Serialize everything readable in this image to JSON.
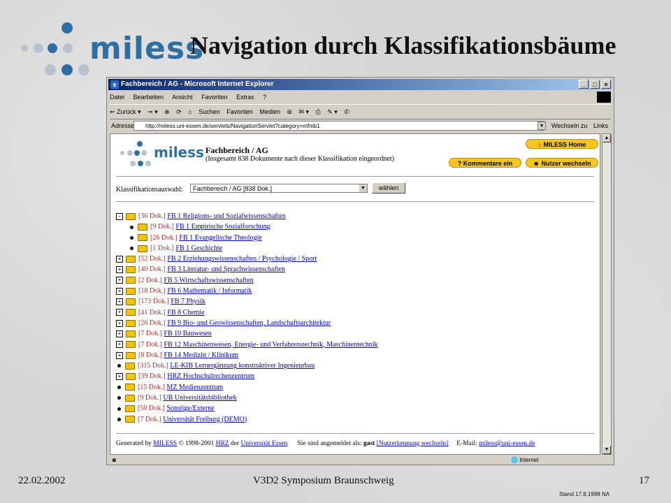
{
  "slide": {
    "title": "Navigation durch Klassifikationsbäume",
    "logo_text": "miless",
    "footer_date": "22.02.2002",
    "footer_event": "V3D2 Symposium Braunschweig",
    "footer_page": "17",
    "stand": "Stand 17.8.1998   NA"
  },
  "browser": {
    "window_title": "Fachbereich / AG - Microsoft Internet Explorer",
    "window_buttons": [
      "_",
      "□",
      "×"
    ],
    "menu": [
      "Datei",
      "Bearbeiten",
      "Ansicht",
      "Favoriten",
      "Extras",
      "?"
    ],
    "toolbar": [
      "⇐ Zurück ▾",
      "⇒ ▾",
      "⊗",
      "⟳",
      "⌂",
      "Suchen",
      "Favoriten",
      "Medien",
      "⊛",
      "✉ ▾",
      "⎙",
      "✎ ▾",
      "✆"
    ],
    "address_label": "Adresse",
    "address_value": "http://miless.uni-essen.de/servlets/NavigationServlet?category=mfmb1",
    "go_label": "Wechseln zu",
    "links_label": "Links",
    "status_zone": "Internet"
  },
  "page": {
    "logo_text": "miless",
    "heading": "Fachbereich / AG",
    "subheading": "(Insgesamt 838 Dokumente nach dieser Klassifikation eingeordnet)",
    "buttons": {
      "home": "MILESS Home",
      "comments": "Kommentare ein",
      "switch_user": "Nutzer wechseln"
    },
    "select_label": "Klassifikationsauswahl:",
    "select_value": "Fachbereich / AG [838 Dok.]",
    "select_button": "wählen",
    "tree": [
      {
        "type": "open",
        "indent": 0,
        "count": "[36 Dok.]",
        "label": "FB 1 Religions- und Sozialwissenschaften"
      },
      {
        "type": "leaf",
        "indent": 1,
        "count": "[9 Dok.]",
        "label": "FB 1 Empirische Sozialforschung"
      },
      {
        "type": "leaf",
        "indent": 1,
        "count": "[26 Dok.]",
        "label": "FB 1 Evangelische Theologie"
      },
      {
        "type": "leaf",
        "indent": 1,
        "count": "[1 Dok.]",
        "label": "FB 1 Geschichte"
      },
      {
        "type": "closed",
        "indent": 0,
        "count": "[52 Dok.]",
        "label": "FB 2 Erziehungswissenschaften / Psychologie / Sport"
      },
      {
        "type": "closed",
        "indent": 0,
        "count": "[40 Dok.]",
        "label": "FB 3 Literatur- und Sprachwissenschaften"
      },
      {
        "type": "closed",
        "indent": 0,
        "count": "[2 Dok.]",
        "label": "FB 5 Wirtschaftswissenschaften"
      },
      {
        "type": "closed",
        "indent": 0,
        "count": "[18 Dok.]",
        "label": "FB 6 Mathematik / Informatik"
      },
      {
        "type": "closed",
        "indent": 0,
        "count": "[173 Dok.]",
        "label": "FB 7 Physik"
      },
      {
        "type": "closed",
        "indent": 0,
        "count": "[41 Dok.]",
        "label": "FB 8 Chemie"
      },
      {
        "type": "closed",
        "indent": 0,
        "count": "[26 Dok.]",
        "label": "FB 9 Bio- und Geowissenschaften, Landschaftsarchitektur"
      },
      {
        "type": "closed",
        "indent": 0,
        "count": "[7 Dok.]",
        "label": "FB 10 Bauwesen"
      },
      {
        "type": "closed",
        "indent": 0,
        "count": "[7 Dok.]",
        "label": "FB 12 Maschinenwesen, Energie- und Verfahrenstechnik, Maschinentechnik"
      },
      {
        "type": "closed",
        "indent": 0,
        "count": "[8 Dok.]",
        "label": "FB 14 Medizin / Klinikum"
      },
      {
        "type": "leaf",
        "indent": 0,
        "count": "[315 Dok.]",
        "label": "LE-KIB Lernergänzung konstruktiver Ingenieurbau"
      },
      {
        "type": "closed",
        "indent": 0,
        "count": "[39 Dok.]",
        "label": "HRZ Hochschulrechenzentrum"
      },
      {
        "type": "leaf",
        "indent": 0,
        "count": "[15 Dok.]",
        "label": "MZ Medienzentrum"
      },
      {
        "type": "leaf",
        "indent": 0,
        "count": "[9 Dok.]",
        "label": "UB Universitätsbibliothek"
      },
      {
        "type": "leaf",
        "indent": 0,
        "count": "[50 Dok.]",
        "label": "Sonstige/Externe"
      },
      {
        "type": "leaf",
        "indent": 0,
        "count": "[7 Dok.]",
        "label": "Universität Freiburg (DEMO)"
      }
    ],
    "footer": {
      "generated_by": "Generated by",
      "miless_link": "MILESS",
      "copyright": "© 1998-2001",
      "hrz_link": "HRZ",
      "der": "der",
      "uni_link": "Universität Essen",
      "login_text": "Sie sind angemeldet als:",
      "user": "gast",
      "change_link": "[Nutzerkennung wechseln]",
      "email_label": "E-Mail:",
      "email_link": "miless@uni-essen.de"
    }
  }
}
